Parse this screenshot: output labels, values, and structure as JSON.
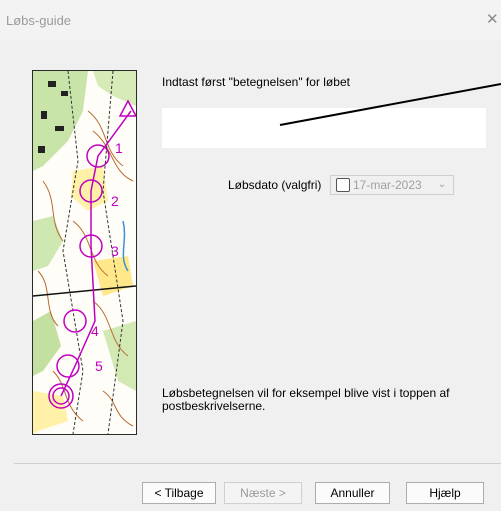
{
  "window": {
    "title": "Løbs-guide",
    "close_icon": "close-icon"
  },
  "main": {
    "prompt": "Indtast først \"betegnelsen\" for løbet",
    "name_input": {
      "value": "",
      "placeholder": ""
    },
    "date_label": "Løbsdato (valgfri)",
    "date_value": "17-mar-2023",
    "date_checked": false,
    "info_text": "Løbsbetegnelsen vil for eksempel blive vist i toppen af postbeskrivelserne."
  },
  "buttons": {
    "back": "< Tilbage",
    "next": "Næste >",
    "cancel": "Annuller",
    "help": "Hjælp"
  },
  "map": {
    "controls": [
      "1",
      "2",
      "3",
      "4",
      "5"
    ],
    "course_color": "#c000c0"
  }
}
